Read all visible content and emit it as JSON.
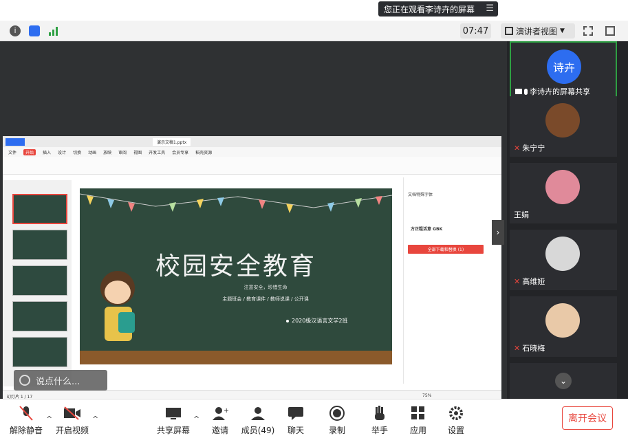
{
  "banner": {
    "text": "您正在观看李诗卉的屏幕"
  },
  "status": {
    "time": "07:47",
    "view_mode": "演讲者视图"
  },
  "participants": [
    {
      "name": "李诗卉的屏幕共享",
      "avatar_text": "诗卉",
      "color": "#2d6df0"
    },
    {
      "name": "朱宁宁",
      "color": "#7a4a2a"
    },
    {
      "name": "王娟",
      "color": "#e08a9a"
    },
    {
      "name": "高维娅",
      "color": "#d8d8d8"
    },
    {
      "name": "石晓梅",
      "color": "#e9c9a8"
    }
  ],
  "slide": {
    "title": "校园安全教育",
    "subtitle": "注意安全，珍惜生命",
    "categories": "主题班会 / 教育课件 / 教师说课 / 公开课",
    "class_line": "2020级汉语言文学2班"
  },
  "ppt": {
    "tab_file": "演示文稿1.pptx",
    "menus": [
      "文件",
      "开始",
      "插入",
      "设计",
      "切换",
      "动画",
      "放映",
      "审阅",
      "视图",
      "开发工具",
      "会员专享",
      "稻壳资源"
    ],
    "slide_counter": "幻灯片 1 / 17",
    "pane_title": "文档特殊字体",
    "pane_font": "方正粗活意 GBK",
    "pane_button": "全部下载和替换 (1)",
    "zoom": "75%"
  },
  "chat": {
    "placeholder": "说点什么..."
  },
  "toolbar": {
    "mute": "解除静音",
    "video": "开启视频",
    "share": "共享屏幕",
    "invite": "邀请",
    "members": "成员(49)",
    "chat": "聊天",
    "record": "录制",
    "hand": "举手",
    "apps": "应用",
    "settings": "设置",
    "leave": "离开会议"
  }
}
